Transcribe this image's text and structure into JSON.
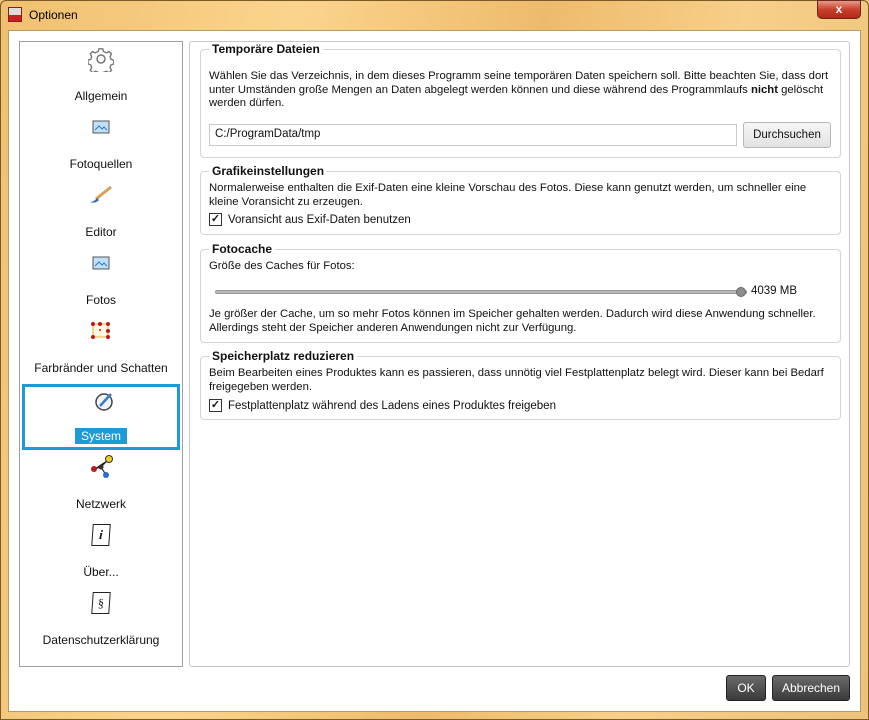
{
  "window": {
    "title": "Optionen",
    "close": "x"
  },
  "sidebar": {
    "items": [
      {
        "label": "Allgemein",
        "icon": "gear-icon"
      },
      {
        "label": "Fotoquellen",
        "icon": "image-icon"
      },
      {
        "label": "Editor",
        "icon": "brush-icon"
      },
      {
        "label": "Fotos",
        "icon": "image-icon"
      },
      {
        "label": "Farbränder und Schatten",
        "icon": "frame-icon"
      },
      {
        "label": "System",
        "icon": "system-icon",
        "selected": true
      },
      {
        "label": "Netzwerk",
        "icon": "network-icon"
      },
      {
        "label": "Über...",
        "icon": "info-icon",
        "glyph": "i"
      },
      {
        "label": "Datenschutzerklärung",
        "icon": "paragraph-icon",
        "glyph": "§"
      }
    ]
  },
  "temp": {
    "title": "Temporäre Dateien",
    "text1": "Wählen Sie das Verzeichnis, in dem dieses Programm seine temporären Daten speichern soll. Bitte beachten Sie, dass dort unter Umständen große Mengen an Daten abgelegt werden können und diese während des Programmlaufs ",
    "bold": "nicht",
    "text2": " gelöscht werden dürfen.",
    "path": "C:/ProgramData/tmp",
    "browse": "Durchsuchen"
  },
  "graphics": {
    "title": "Grafikeinstellungen",
    "text": "Normalerweise enthalten die Exif-Daten eine kleine Vorschau des Fotos. Diese kann genutzt werden, um schneller eine kleine Voransicht zu erzeugen.",
    "checkbox": "Voransicht aus Exif-Daten benutzen",
    "checked": true
  },
  "cache": {
    "title": "Fotocache",
    "label": "Größe des Caches für Fotos:",
    "value_text": "4039 MB",
    "slider_fraction": 1.0,
    "text": "Je größer der Cache, um so mehr Fotos können im Speicher gehalten werden. Dadurch wird diese Anwendung schneller. Allerdings steht der Speicher anderen Anwendungen nicht zur Verfügung."
  },
  "storage": {
    "title": "Speicherplatz reduzieren",
    "text": "Beim Bearbeiten eines Produktes kann es passieren, dass unnötig viel Festplattenplatz belegt wird. Dieser kann bei Bedarf freigegeben werden.",
    "checkbox": "Festplattenplatz während des Ladens eines Produktes freigeben",
    "checked": true
  },
  "buttons": {
    "ok": "OK",
    "cancel": "Abbrechen"
  },
  "colors": {
    "accent": "#1e9bd7"
  }
}
